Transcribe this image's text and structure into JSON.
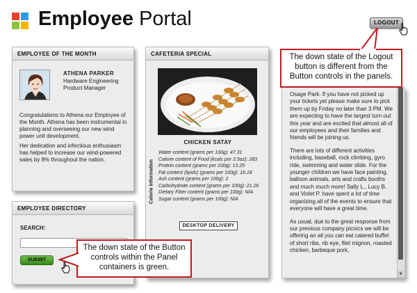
{
  "header": {
    "title_bold": "Employee",
    "title_rest": "Portal",
    "logout_label": "LOGOUT"
  },
  "colors": {
    "logo": [
      "#e8412c",
      "#2e9be3",
      "#8cc63f",
      "#f5b400"
    ],
    "callout_border": "#c0191f",
    "submit_green": "#4faa2e"
  },
  "employee_of_month": {
    "heading": "EMPLOYEE OF THE MONTH",
    "name": "ATHENA PARKER",
    "role": "Hardware Engineering Product Manager",
    "para1": "Congratulations to Athena our Employee of the Month. Athena has been instrumental in planning and overseeing our new wind power unit development.",
    "para2": "Her dedication and infectious enthusiasm has helped to increase our wind-powered sales by 8% throughout the nation."
  },
  "directory": {
    "heading": "EMPLOYEE DIRECTORY",
    "search_label": "SEARCH:",
    "search_value": "",
    "submit_label": "SUBMIT"
  },
  "cafeteria": {
    "heading": "CAFETERIA SPECIAL",
    "dish": "CHICKEN SATAY",
    "side_label": "Calorie Information",
    "nutrition": [
      "Water content (grams per 100g): 47.31",
      "Calorie content of Food (kcals per 3.5oz): 283",
      "Protein content (grams per 100g): 13.25",
      "Fat content (lipids) (grams per 100g): 16.18",
      "Ash content (grams per 100g): 2",
      "Carbohydrate content (grams per 100g): 21.26",
      "Dietary Fiber content (grams per 100g): N/A",
      "Sugar content (grams per 100g): N/A"
    ],
    "delivery_label": "DESKTOP DELIVERY"
  },
  "news": {
    "paragraphs": [
      "Osage Park. If you have not picked up your tickets yet please make sure to pick them up by Friday no later than 3 PM. We are expecting to have the largest turn out this year and are excited that almost all of our employees and their families and friends will be joining us.",
      "There are lots of different activities including, baseball, rock climbing, gyro ride, swimming and water slide. For the younger children we have face painting, balloon animals, arts and crafts booths and much much more! Sally L., Lucy B. and Violet P. have spent a lot of time organizing all of the events to ensure that everyone will have a great time.",
      "As usual, due to the great response from our previous company picnics we will be offering an all you can eat catered buffet of short ribs, rib eye, filet mignon, roasted chicken, barbeque pork,"
    ],
    "scroll_down": "▼"
  },
  "callouts": {
    "logout_note": "The down state of the Logout button is different from the Button controls in the panels.",
    "submit_note": "The down state of the Button controls within the Panel containers is green."
  }
}
